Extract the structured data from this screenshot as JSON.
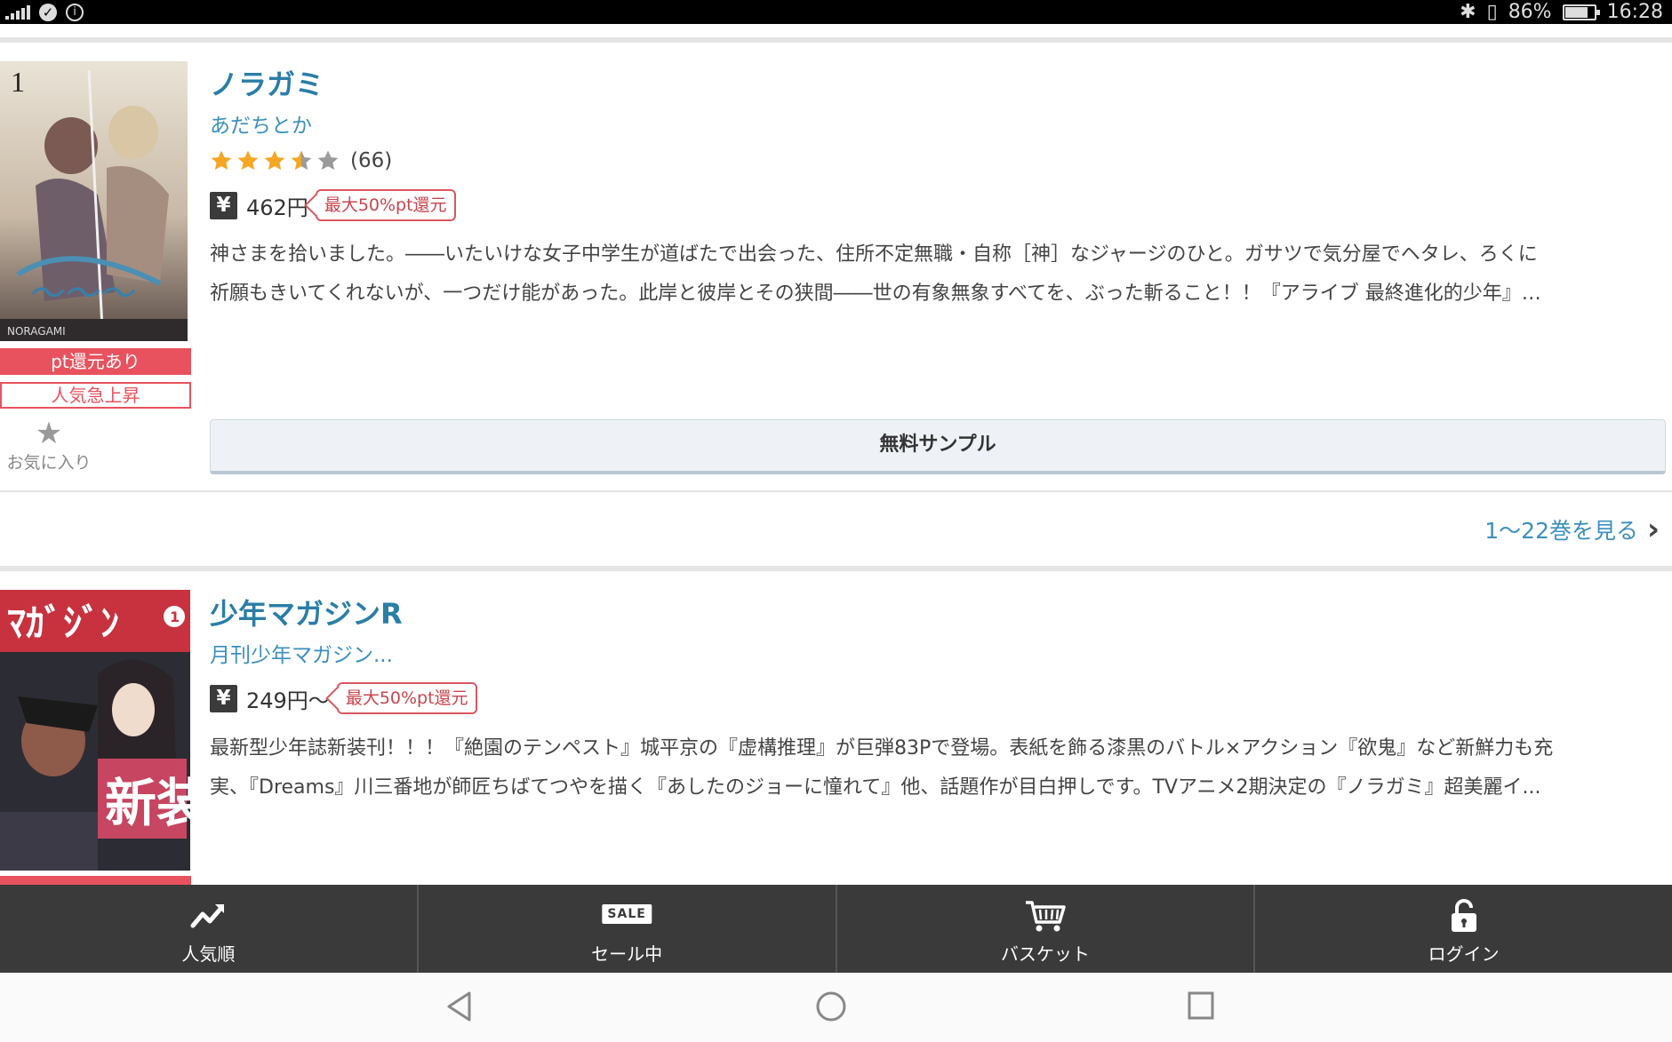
{
  "status_bar": {
    "battery": "86%",
    "time": "16:28"
  },
  "books": [
    {
      "title": "ノラガミ",
      "author": "あだちとか",
      "rating": 3.5,
      "rating_count": "(66)",
      "price": "462円",
      "pt_tag": "最大50%pt還元",
      "badges": [
        "pt還元あり",
        "人気急上昇"
      ],
      "favorite_label": "お気に入り",
      "description_lines": [
        "神さまを拾いました。――いたいけな女子中学生が道ばたで出会った、住所不定無職・自称［神］なジャージのひと。ガサツで気分屋でヘタレ、ろくに",
        "祈願もきいてくれないが、一つだけ能があった。此岸と彼岸とその狭間――世の有象無象すべてを、ぶった斬ること！！『アライブ 最終進化的少年』…"
      ],
      "sample_button": "無料サンプル",
      "volumes_link": "1〜22巻を見る"
    },
    {
      "title": "少年マガジンR",
      "author": "月刊少年マガジン...",
      "price": "249円〜",
      "pt_tag": "最大50%pt還元",
      "description_lines": [
        "最新型少年誌新装刊！！！『絶園のテンペスト』城平京の『虚構推理』が巨弾83Pで登場。表紙を飾る漆黒のバトル×アクション『欲鬼』など新鮮力も充",
        "実、『Dreams』川三番地が師匠ちばてつやを描く『あしたのジョーに憧れて』他、話題作が目白押しです。TVアニメ2期決定の『ノラガミ』超美麗イ..."
      ]
    }
  ],
  "tabs": [
    {
      "label": "人気順",
      "icon": "trending-up-icon"
    },
    {
      "label": "セール中",
      "icon": "sale-icon",
      "icon_text": "SALE"
    },
    {
      "label": "バスケット",
      "icon": "cart-icon"
    },
    {
      "label": "ログイン",
      "icon": "unlock-icon"
    }
  ],
  "colors": {
    "title": "#2a7ea8",
    "badge_red": "#e8525e",
    "star": "#f5a623",
    "tabbar": "#3a3a3a"
  }
}
